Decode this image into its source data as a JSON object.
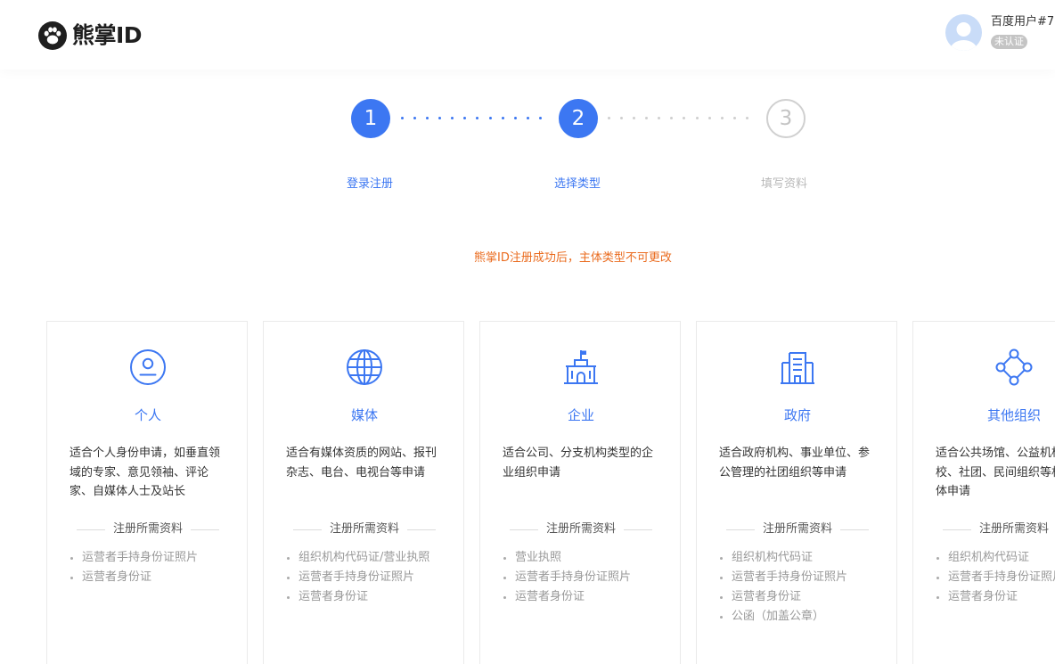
{
  "header": {
    "logo_text": "熊掌ID",
    "user": {
      "name": "百度用户#7",
      "badge": "未认证"
    }
  },
  "steps": [
    {
      "number": "1",
      "label": "登录注册",
      "state": "done"
    },
    {
      "number": "2",
      "label": "选择类型",
      "state": "current"
    },
    {
      "number": "3",
      "label": "填写资料",
      "state": "pending"
    }
  ],
  "notice": "熊掌ID注册成功后，主体类型不可更改",
  "cards": [
    {
      "icon": "person-icon",
      "title": "个人",
      "description": "适合个人身份申请，如垂直领域的专家、意见领袖、评论家、自媒体人士及站长",
      "requirements_heading": "注册所需资料",
      "requirements": [
        "运营者手持身份证照片",
        "运营者身份证"
      ]
    },
    {
      "icon": "globe-icon",
      "title": "媒体",
      "description": "适合有媒体资质的网站、报刊杂志、电台、电视台等申请",
      "requirements_heading": "注册所需资料",
      "requirements": [
        "组织机构代码证/营业执照",
        "运营者手持身份证照片",
        "运营者身份证"
      ]
    },
    {
      "icon": "building-flag-icon",
      "title": "企业",
      "description": "适合公司、分支机构类型的企业组织申请",
      "requirements_heading": "注册所需资料",
      "requirements": [
        "营业执照",
        "运营者手持身份证照片",
        "运营者身份证"
      ]
    },
    {
      "icon": "government-building-icon",
      "title": "政府",
      "description": "适合政府机构、事业单位、参公管理的社团组织等申请",
      "requirements_heading": "注册所需资料",
      "requirements": [
        "组织机构代码证",
        "运营者手持身份证照片",
        "运营者身份证",
        "公函（加盖公章）"
      ]
    },
    {
      "icon": "network-nodes-icon",
      "title": "其他组织",
      "description": "适合公共场馆、公益机构、学校、社团、民间组织等机构团体申请",
      "requirements_heading": "注册所需资料",
      "requirements": [
        "组织机构代码证",
        "运营者手持身份证照片",
        "运营者身份证"
      ]
    }
  ],
  "colors": {
    "accent": "#3c77f2",
    "notice": "#ea6b1e",
    "muted": "#999999"
  }
}
